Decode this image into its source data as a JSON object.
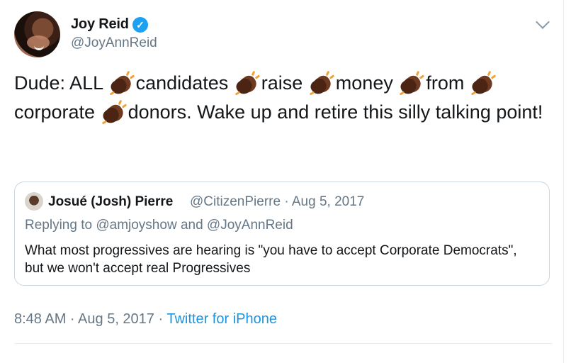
{
  "author": {
    "name": "Joy Reid",
    "handle": "@JoyAnnReid",
    "verified": true
  },
  "tweet": {
    "segments": [
      "Dude: ALL",
      "candidates",
      "raise",
      "money",
      "from",
      "corporate",
      "donors. Wake up and retire this silly talking point!"
    ],
    "emoji": "clapping-hands-dark-skin-tone"
  },
  "quote": {
    "name": "Josué (Josh) Pierre",
    "handle_date": "@CitizenPierre · Aug 5, 2017",
    "replying_to": "Replying to @amjoyshow and @JoyAnnReid",
    "text": "What most progressives are hearing is \"you have to accept Corporate Democrats\", but we won't accept real Progressives"
  },
  "meta": {
    "time_date": "8:48 AM · Aug 5, 2017 · ",
    "source": "Twitter for iPhone"
  },
  "colors": {
    "text": "#14171a",
    "secondary": "#657786",
    "link": "#1b95e0",
    "verified": "#1da1f2",
    "border": "#ccd6dd"
  }
}
